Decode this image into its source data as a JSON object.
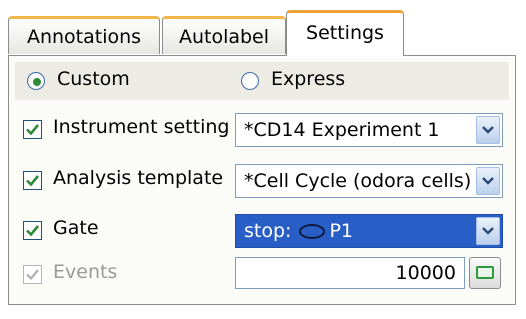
{
  "tabs": [
    {
      "label": "Annotations",
      "active": false
    },
    {
      "label": "Autolabel",
      "active": false
    },
    {
      "label": "Settings",
      "active": true
    }
  ],
  "mode": {
    "custom_label": "Custom",
    "express_label": "Express",
    "selected": "Custom"
  },
  "instrument": {
    "label": "Instrument setting",
    "checked": true,
    "value": "*CD14 Experiment 1"
  },
  "analysis": {
    "label": "Analysis template",
    "checked": true,
    "value": "*Cell Cycle (odora cells)"
  },
  "gate": {
    "label": "Gate",
    "checked": true,
    "prefix": "stop:",
    "value": "P1",
    "icon": "ellipse-gate-icon"
  },
  "events": {
    "label": "Events",
    "checked": true,
    "enabled": false,
    "value": "10000"
  },
  "colors": {
    "tab_accent": "#f0a238",
    "selection": "#2a5ec7",
    "check": "#2d8a37"
  }
}
